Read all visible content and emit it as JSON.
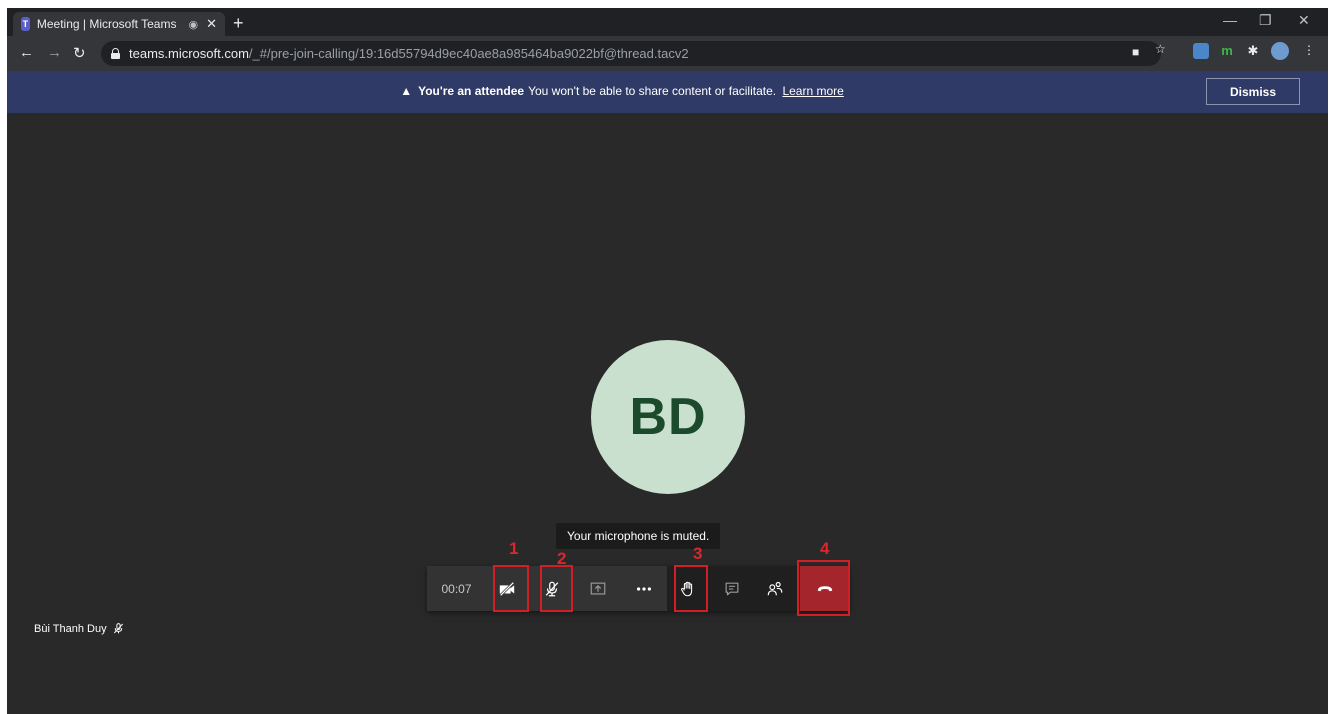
{
  "browser": {
    "tab": {
      "favicon": "teams-icon",
      "title": "Meeting | Microsoft Teams",
      "audio_icon": "recording-dot-icon",
      "close_icon": "close-icon"
    },
    "new_tab_icon": "plus-icon",
    "window_controls": [
      "minimize-icon",
      "restore-icon",
      "close-icon"
    ],
    "nav": [
      "back-icon",
      "forward-icon",
      "reload-icon"
    ],
    "url_host": "teams.microsoft.com",
    "url_path": "/_#/pre-join-calling/19:16d55794d9ec40ae8a985464ba9022bf@thread.tacv2",
    "omnibox_icons": [
      "camera-icon",
      "star-icon"
    ],
    "extensions": [
      "translate-extension-icon",
      "green-extension-icon",
      "puzzle-extensions-icon",
      "profile-avatar-icon",
      "kebab-menu-icon"
    ]
  },
  "banner": {
    "warning_icon": "▲",
    "bold": "You're an attendee",
    "text": "You won't be able to share content or facilitate.",
    "link": "Learn more",
    "dismiss": "Dismiss",
    "color": "#2f3b66"
  },
  "stage": {
    "avatar_initials": "BD",
    "avatar_color": "#c8e0cd",
    "tooltip": "Your microphone is muted.",
    "participant_name": "Bùi Thanh Duy"
  },
  "controls": {
    "timer": "00:07",
    "buttons": [
      "camera-off-icon",
      "mic-muted-icon",
      "share-screen-icon",
      "more-options-icon",
      "raise-hand-icon",
      "chat-icon",
      "participants-icon",
      "hang-up-icon"
    ],
    "hangup_color": "#a4262c"
  },
  "annotations": {
    "labels": [
      "1",
      "2",
      "3",
      "4"
    ],
    "color": "#d21f26"
  }
}
